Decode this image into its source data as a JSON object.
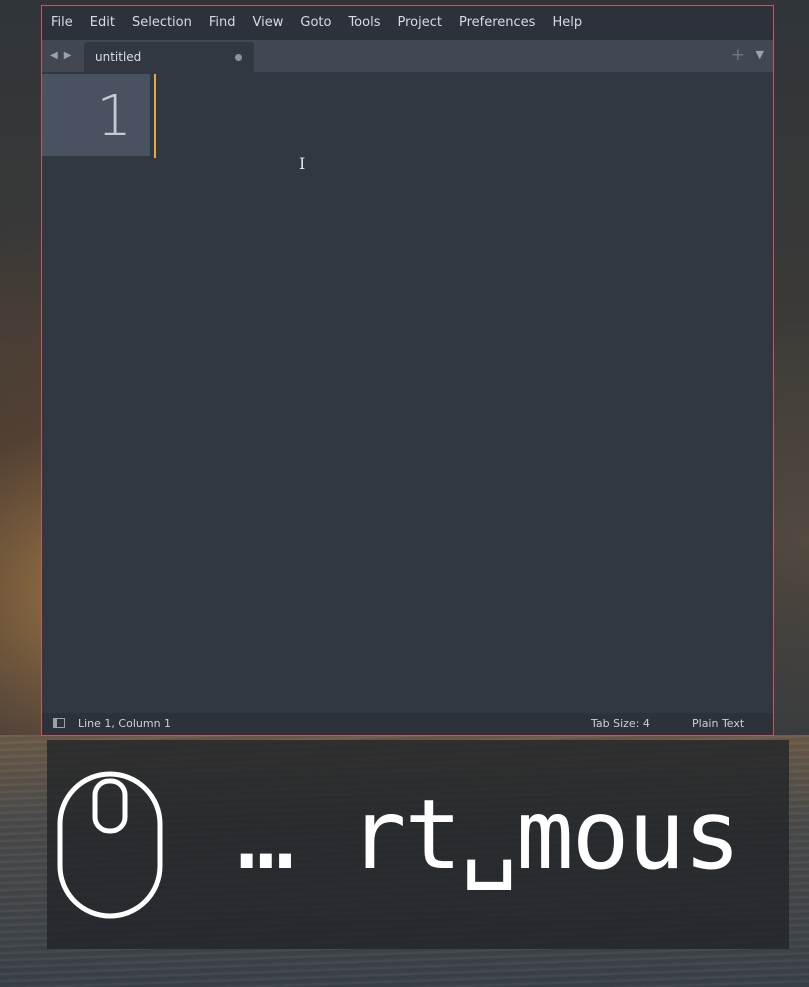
{
  "menubar": {
    "items": [
      "File",
      "Edit",
      "Selection",
      "Find",
      "View",
      "Goto",
      "Tools",
      "Project",
      "Preferences",
      "Help"
    ]
  },
  "tabbar": {
    "nav_back_icon": "triangle-left-icon",
    "nav_forward_icon": "triangle-right-icon",
    "active_tab": {
      "label": "untitled",
      "modified": true
    },
    "new_tab_icon": "plus-icon",
    "tab_list_icon": "triangle-down-icon"
  },
  "editor": {
    "line_numbers": [
      "1"
    ],
    "content": "",
    "caret_color": "#e8a93e"
  },
  "statusbar": {
    "position": "Line 1, Column 1",
    "tab_size": "Tab Size: 4",
    "syntax": "Plain Text"
  },
  "overlay": {
    "icon": "mouse-icon",
    "text": "… rt␣mous"
  },
  "colors": {
    "window_border": "#c8565e",
    "editor_bg": "#323842",
    "menubar_bg": "#2c313a",
    "accent": "#e8a93e"
  }
}
